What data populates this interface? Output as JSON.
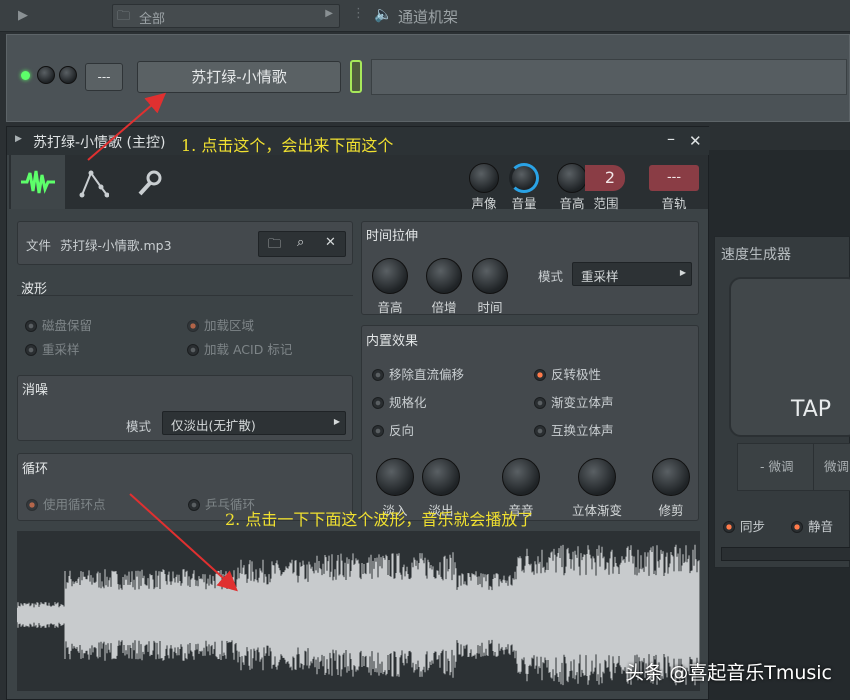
{
  "topbar": {
    "filter_label": "全部",
    "rack_title": "通道机架"
  },
  "rack": {
    "channel_number": "---",
    "channel_name": "苏打绿-小情歌"
  },
  "window": {
    "title": "苏打绿-小情歌 (主控)",
    "minimize": "–",
    "close": "✕"
  },
  "header_knobs": {
    "pan": "声像",
    "volume": "音量",
    "pitch": "音高",
    "range_value": "2",
    "range_label": "范围",
    "track_value": "---",
    "track_label": "音轨"
  },
  "file": {
    "label": "文件",
    "value": "苏打绿-小情歌.mp3"
  },
  "waveform": {
    "title": "波形",
    "opt1": "磁盘保留",
    "opt2": "加载区域",
    "opt3": "重采样",
    "opt4": "加载 ACID 标记"
  },
  "declick": {
    "title": "消噪",
    "mode_label": "模式",
    "mode_value": "仅淡出(无扩散)"
  },
  "loop": {
    "title": "循环",
    "opt1": "使用循环点",
    "opt2": "乒乓循环"
  },
  "stretch": {
    "title": "时间拉伸",
    "k1": "音高",
    "k2": "倍增",
    "k3": "时间",
    "mode_label": "模式",
    "mode_value": "重采样"
  },
  "effects": {
    "title": "内置效果",
    "e1": "移除直流偏移",
    "e2": "反转极性",
    "e3": "规格化",
    "e4": "渐变立体声",
    "e5": "反向",
    "e6": "互换立体声",
    "k1": "淡入",
    "k2": "淡出",
    "k3": "音音",
    "k4": "立体渐变",
    "k5": "修剪"
  },
  "speed": {
    "title": "速度生成器",
    "tap": "TAP",
    "nudge_down": "- 微调",
    "nudge_up": "微调",
    "sync": "同步",
    "mute": "静音"
  },
  "annotations": {
    "a1": "1. 点击这个，会出来下面这个",
    "a2": "2. 点击一下下面这个波形，音乐就会播放了"
  },
  "watermark": "头条 @喜起音乐Tmusic",
  "colors": {
    "accent": "#f0e030",
    "wave": "#c8cbcd",
    "orange": "#ff7a4a",
    "green": "#5dff6a"
  }
}
